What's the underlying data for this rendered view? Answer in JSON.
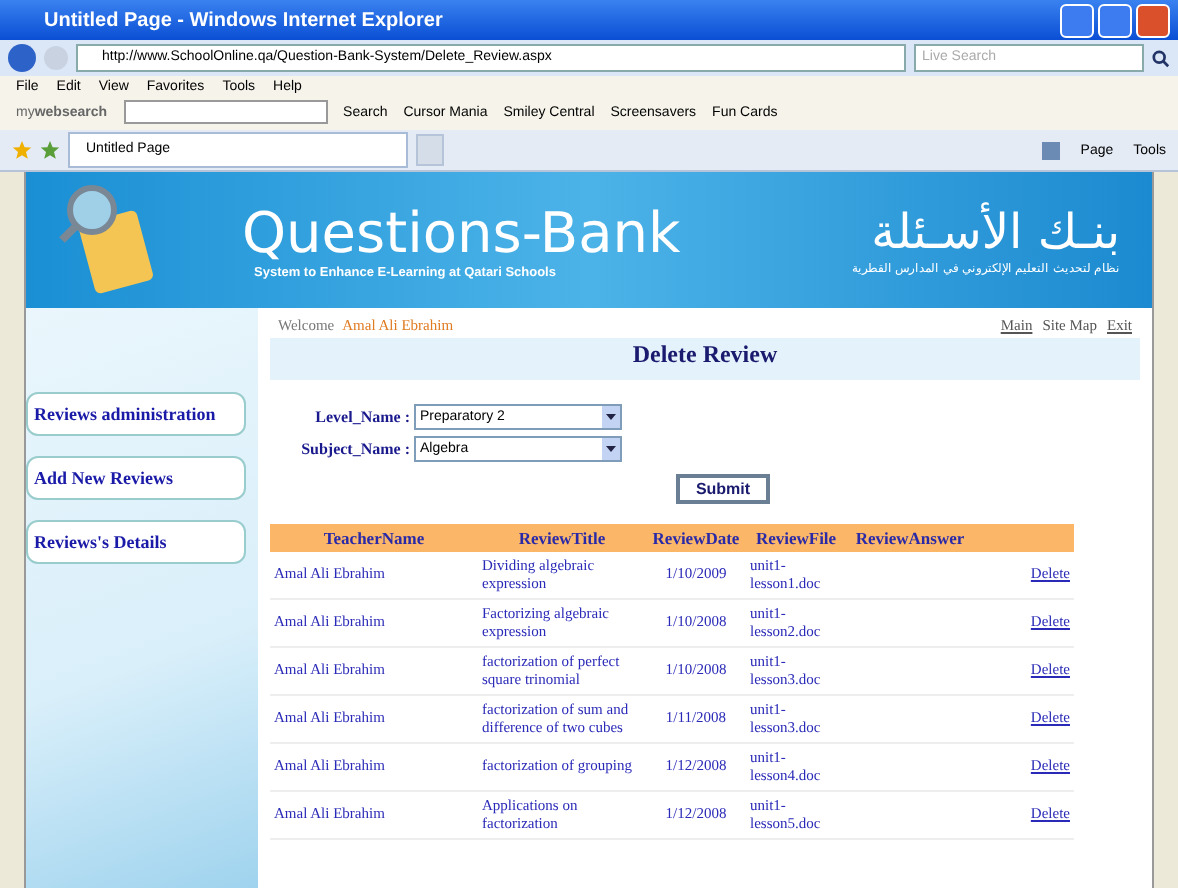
{
  "window": {
    "title": "Untitled Page - Windows Internet Explorer"
  },
  "address_bar": {
    "url": "http://www.SchoolOnline.qa/Question-Bank-System/Delete_Review.aspx",
    "search_placeholder": "Live Search"
  },
  "menu": [
    "File",
    "Edit",
    "View",
    "Favorites",
    "Tools",
    "Help"
  ],
  "search_toolbar": {
    "brand": "my**websearch**",
    "items": [
      "Search",
      "Cursor Mania",
      "Smiley Central",
      "Screensavers",
      "Fun Cards"
    ]
  },
  "tab": {
    "title": "Untitled Page"
  },
  "command_bar": [
    "Page",
    "Tools"
  ],
  "header": {
    "title": "Questions-Bank",
    "subtitle": "System to Enhance E-Learning at Qatari Schools",
    "arabic_title": "بنـك الأسـئلة",
    "arabic_subtitle": "نظام لتحديث التعليم الإلكتروني في المدارس القطرية"
  },
  "welcome": {
    "label": "Welcome",
    "user": "Amal Ali Ebrahim"
  },
  "top_links": [
    "Main",
    "Site Map",
    "Exit"
  ],
  "page_title": "Delete Review",
  "sidebar": {
    "items": [
      "Reviews administration",
      "Add New Reviews",
      "Reviews's Details"
    ]
  },
  "form": {
    "fields": [
      {
        "label": "Level_Name :",
        "value": "Preparatory 2"
      },
      {
        "label": "Subject_Name :",
        "value": "Algebra"
      }
    ],
    "submit": "Submit"
  },
  "table": {
    "columns": [
      "TeacherName",
      "ReviewTitle",
      "ReviewDate",
      "ReviewFile",
      "ReviewAnswer"
    ],
    "rows": [
      {
        "cells": [
          "Amal Ali Ebrahim",
          "Dividing algebraic expression",
          "1/10/2009",
          "unit1-lesson1.doc",
          ""
        ],
        "action": "Delete"
      },
      {
        "cells": [
          "Amal Ali Ebrahim",
          "Factorizing algebraic expression",
          "1/10/2008",
          "unit1-lesson2.doc",
          ""
        ],
        "action": "Delete"
      },
      {
        "cells": [
          "Amal Ali Ebrahim",
          "factorization of perfect square trinomial",
          "1/10/2008",
          "unit1-lesson3.doc",
          ""
        ],
        "action": "Delete"
      },
      {
        "cells": [
          "Amal Ali Ebrahim",
          "factorization of sum and difference of two cubes",
          "1/11/2008",
          "unit1-lesson3.doc",
          ""
        ],
        "action": "Delete"
      },
      {
        "cells": [
          "Amal Ali Ebrahim",
          "factorization of grouping",
          "1/12/2008",
          "unit1-lesson4.doc",
          ""
        ],
        "action": "Delete"
      },
      {
        "cells": [
          "Amal Ali Ebrahim",
          "Applications on factorization",
          "1/12/2008",
          "unit1-lesson5.doc",
          ""
        ],
        "action": "Delete"
      }
    ]
  }
}
